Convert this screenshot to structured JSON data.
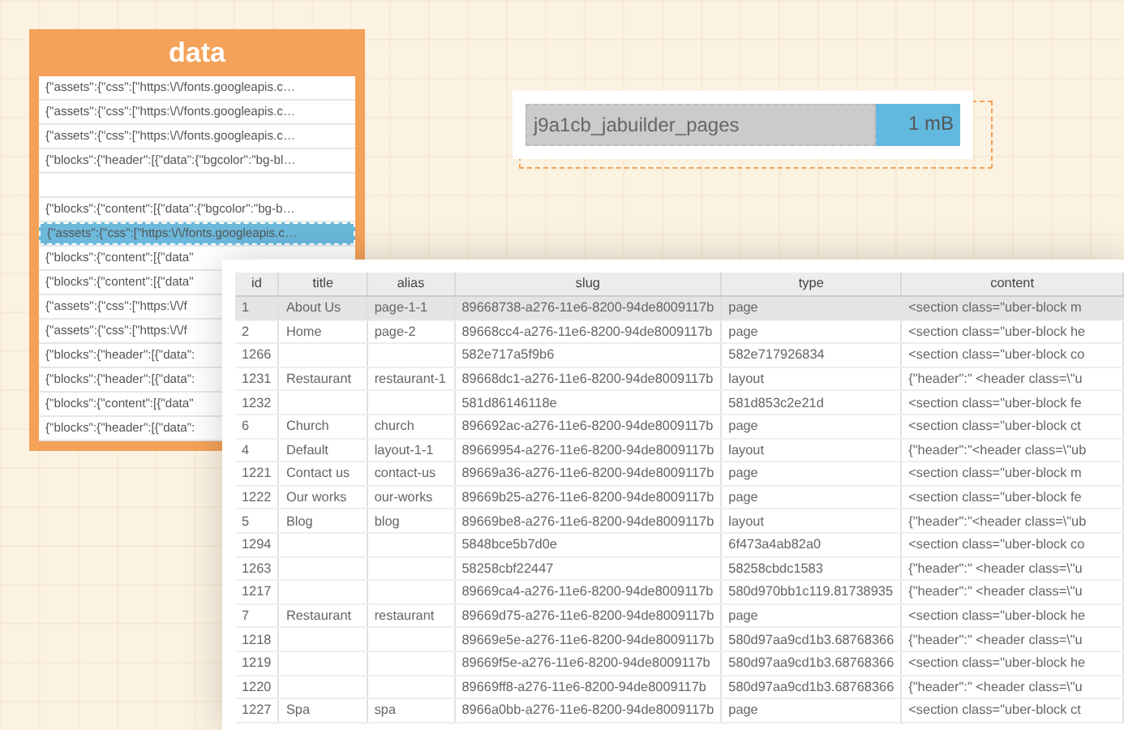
{
  "data_panel": {
    "title": "data",
    "rows": [
      {
        "text": "{\"assets\":{\"css\":[\"https:\\/\\/fonts.googleapis.c…",
        "selected": false
      },
      {
        "text": "{\"assets\":{\"css\":[\"https:\\/\\/fonts.googleapis.c…",
        "selected": false
      },
      {
        "text": "{\"assets\":{\"css\":[\"https:\\/\\/fonts.googleapis.c…",
        "selected": false
      },
      {
        "text": "{\"blocks\":{\"header\":[{\"data\":{\"bgcolor\":\"bg-bl…",
        "selected": false
      },
      {
        "selected": false
      },
      {
        "text": "{\"blocks\":{\"content\":[{\"data\":{\"bgcolor\":\"bg-b…",
        "selected": false
      },
      {
        "text": "{\"assets\":{\"css\":[\"https:\\/\\/fonts.googleapis.c…",
        "selected": true
      },
      {
        "text": "{\"blocks\":{\"content\":[{\"data\"",
        "selected": false
      },
      {
        "text": "{\"blocks\":{\"content\":[{\"data\"",
        "selected": false
      },
      {
        "text": "{\"assets\":{\"css\":[\"https:\\/\\/f",
        "selected": false
      },
      {
        "text": "{\"assets\":{\"css\":[\"https:\\/\\/f",
        "selected": false
      },
      {
        "text": "{\"blocks\":{\"header\":[{\"data\":",
        "selected": false
      },
      {
        "text": "{\"blocks\":{\"header\":[{\"data\":",
        "selected": false
      },
      {
        "text": "{\"blocks\":{\"content\":[{\"data\"",
        "selected": false
      },
      {
        "text": "{\"blocks\":{\"header\":[{\"data\":",
        "selected": false
      }
    ]
  },
  "table_card": {
    "name": "j9a1cb_jabuilder_pages",
    "size": "1 mB"
  },
  "table_window": {
    "columns": [
      "id",
      "title",
      "alias",
      "slug",
      "type",
      "content"
    ],
    "rows": [
      {
        "cells": [
          "1",
          "About Us",
          "page-1-1",
          "89668738-a276-11e6-8200-94de8009117b",
          "page",
          "<section class=\"uber-block m"
        ],
        "selected": true
      },
      {
        "cells": [
          "2",
          "Home",
          "page-2",
          "89668cc4-a276-11e6-8200-94de8009117b",
          "page",
          "<section class=\"uber-block he"
        ],
        "selected": false
      },
      {
        "cells": [
          "1266",
          null,
          null,
          "582e717a5f9b6",
          "582e717926834",
          "<section class=\"uber-block co"
        ],
        "selected": false
      },
      {
        "cells": [
          "1231",
          "Restaurant",
          "restaurant-1",
          "89668dc1-a276-11e6-8200-94de8009117b",
          "layout",
          "{\"header\":\" <header class=\\\"u"
        ],
        "selected": false
      },
      {
        "cells": [
          "1232",
          null,
          null,
          "581d86146118e",
          "581d853c2e21d",
          "<section class=\"uber-block fe"
        ],
        "selected": false
      },
      {
        "cells": [
          "6",
          "Church",
          "church",
          "896692ac-a276-11e6-8200-94de8009117b",
          "page",
          "<section class=\"uber-block ct"
        ],
        "selected": false
      },
      {
        "cells": [
          "4",
          "Default",
          "layout-1-1",
          "89669954-a276-11e6-8200-94de8009117b",
          "layout",
          "{\"header\":\"<header class=\\\"ub"
        ],
        "selected": false
      },
      {
        "cells": [
          "1221",
          "Contact us",
          "contact-us",
          "89669a36-a276-11e6-8200-94de8009117b",
          "page",
          "<section class=\"uber-block m"
        ],
        "selected": false
      },
      {
        "cells": [
          "1222",
          "Our works",
          "our-works",
          "89669b25-a276-11e6-8200-94de8009117b",
          "page",
          "<section class=\"uber-block fe"
        ],
        "selected": false
      },
      {
        "cells": [
          "5",
          "Blog",
          "blog",
          "89669be8-a276-11e6-8200-94de8009117b",
          "layout",
          "{\"header\":\"<header class=\\\"ub"
        ],
        "selected": false
      },
      {
        "cells": [
          "1294",
          null,
          null,
          "5848bce5b7d0e",
          "6f473a4ab82a0",
          "<section class=\"uber-block co"
        ],
        "selected": false
      },
      {
        "cells": [
          "1263",
          null,
          null,
          "58258cbf22447",
          "58258cbdc1583",
          "{\"header\":\" <header class=\\\"u"
        ],
        "selected": false
      },
      {
        "cells": [
          "1217",
          null,
          null,
          "89669ca4-a276-11e6-8200-94de8009117b",
          "580d970bb1c119.81738935",
          "{\"header\":\" <header class=\\\"u"
        ],
        "selected": false
      },
      {
        "cells": [
          "7",
          "Restaurant",
          "restaurant",
          "89669d75-a276-11e6-8200-94de8009117b",
          "page",
          "<section class=\"uber-block he"
        ],
        "selected": false
      },
      {
        "cells": [
          "1218",
          null,
          null,
          "89669e5e-a276-11e6-8200-94de8009117b",
          "580d97aa9cd1b3.68768366",
          "{\"header\":\" <header class=\\\"u"
        ],
        "selected": false
      },
      {
        "cells": [
          "1219",
          null,
          null,
          "89669f5e-a276-11e6-8200-94de8009117b",
          "580d97aa9cd1b3.68768366",
          "<section class=\"uber-block he"
        ],
        "selected": false
      },
      {
        "cells": [
          "1220",
          null,
          null,
          "89669ff8-a276-11e6-8200-94de8009117b",
          "580d97aa9cd1b3.68768366",
          "{\"header\":\" <header class=\\\"u"
        ],
        "selected": false
      },
      {
        "cells": [
          "1227",
          "Spa",
          "spa",
          "8966a0bb-a276-11e6-8200-94de8009117b",
          "page",
          "<section class=\"uber-block ct"
        ],
        "selected": false
      }
    ]
  }
}
